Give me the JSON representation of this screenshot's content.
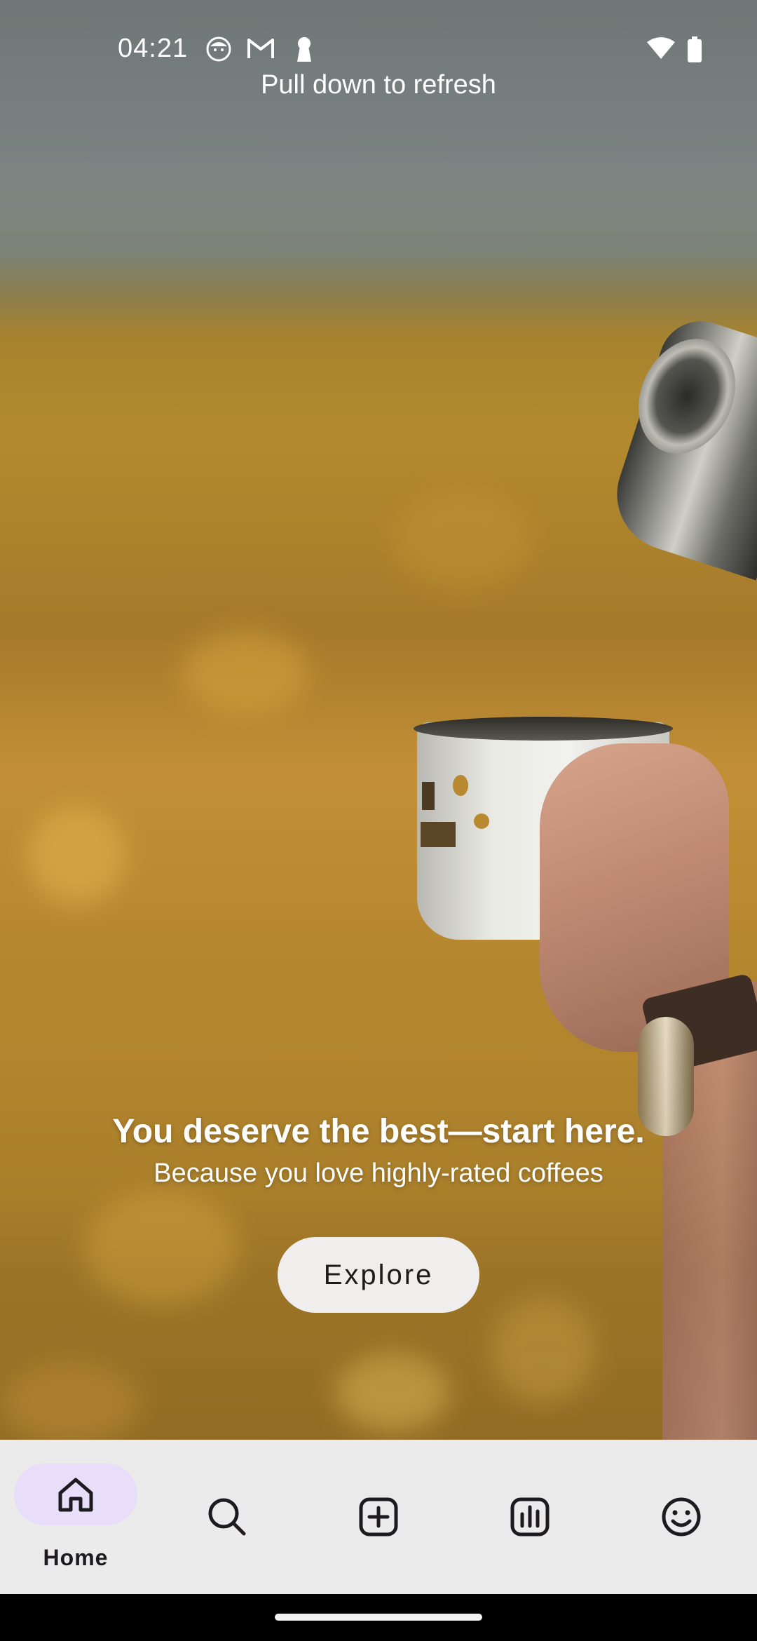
{
  "status_bar": {
    "time": "04:21",
    "notification_icons": [
      "face-icon",
      "gmail-icon",
      "keyhole-icon"
    ],
    "system_icons": [
      "wifi-icon",
      "battery-icon"
    ]
  },
  "refresh_hint": "Pull down to refresh",
  "promo": {
    "title": "You deserve the best—start here.",
    "subtitle": "Because you love highly-rated coffees",
    "button_label": "Explore"
  },
  "bottom_nav": {
    "items": [
      {
        "label": "Home",
        "icon": "home-icon",
        "selected": true
      },
      {
        "label": "",
        "icon": "search-icon",
        "selected": false
      },
      {
        "label": "",
        "icon": "add-box-icon",
        "selected": false
      },
      {
        "label": "",
        "icon": "stats-icon",
        "selected": false
      },
      {
        "label": "",
        "icon": "smiley-icon",
        "selected": false
      }
    ]
  },
  "colors": {
    "nav_background": "#ebebeb",
    "nav_selected_pill": "#e8defa",
    "button_background": "#efeeed",
    "text_on_image": "#ffffff"
  }
}
